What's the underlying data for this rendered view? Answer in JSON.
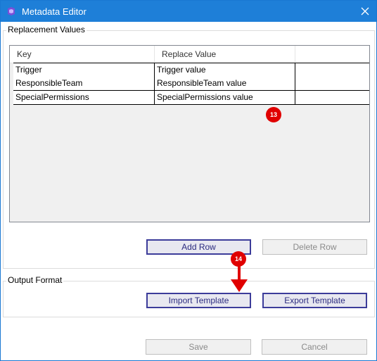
{
  "window": {
    "title": "Metadata Editor",
    "title_bar_color": "#1e7fd8"
  },
  "replacement": {
    "label": "Replacement Values",
    "columns": [
      "Key",
      "Replace Value"
    ],
    "rows": [
      {
        "key": "Trigger",
        "value": "Trigger value"
      },
      {
        "key": "ResponsibleTeam",
        "value": "ResponsibleTeam value"
      },
      {
        "key": "SpecialPermissions",
        "value": "SpecialPermissions value"
      }
    ],
    "add_row": "Add Row",
    "delete_row": "Delete Row"
  },
  "output": {
    "label": "Output Format",
    "import": "Import Template",
    "export": "Export Template"
  },
  "footer": {
    "save": "Save",
    "cancel": "Cancel"
  },
  "annotations": {
    "badge_13": "13",
    "badge_14": "14",
    "color": "#e00000"
  },
  "icons": {
    "app": "app-logo-icon",
    "close": "close-icon"
  }
}
